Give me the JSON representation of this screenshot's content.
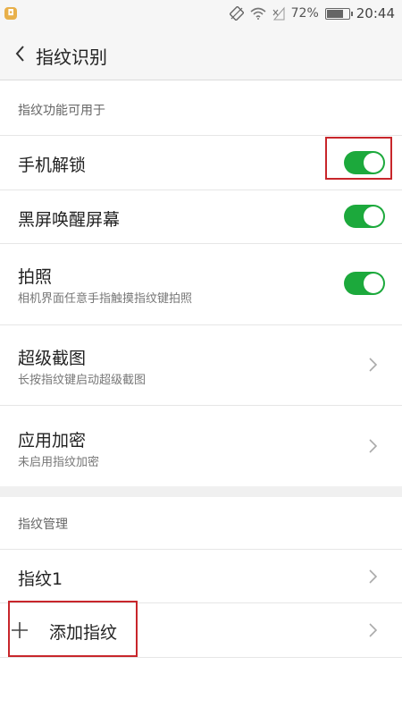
{
  "status_bar": {
    "notification_icon": "app-notification-icon",
    "icons": [
      "rotation-lock-icon",
      "wifi-icon",
      "no-signal-icon"
    ],
    "battery_percent": "72%",
    "time": "20:44"
  },
  "header": {
    "back_icon": "chevron-left-icon",
    "title": "指纹识别"
  },
  "section_usage": {
    "header": "指纹功能可用于",
    "items": [
      {
        "title": "手机解锁",
        "subtitle": "",
        "control": "toggle",
        "on": true
      },
      {
        "title": "黑屏唤醒屏幕",
        "subtitle": "",
        "control": "toggle",
        "on": true
      },
      {
        "title": "拍照",
        "subtitle": "相机界面任意手指触摸指纹键拍照",
        "control": "toggle",
        "on": true
      },
      {
        "title": "超级截图",
        "subtitle": "长按指纹键启动超级截图",
        "control": "chevron"
      },
      {
        "title": "应用加密",
        "subtitle": "未启用指纹加密",
        "control": "chevron"
      }
    ]
  },
  "section_manage": {
    "header": "指纹管理",
    "items": [
      {
        "title": "指纹1",
        "control": "chevron"
      },
      {
        "title": "添加指纹",
        "control": "chevron",
        "icon": "plus-icon"
      }
    ]
  },
  "colors": {
    "toggle_on": "#1ca93c",
    "highlight": "#c8262b",
    "header_bg": "#f6f6f6"
  }
}
